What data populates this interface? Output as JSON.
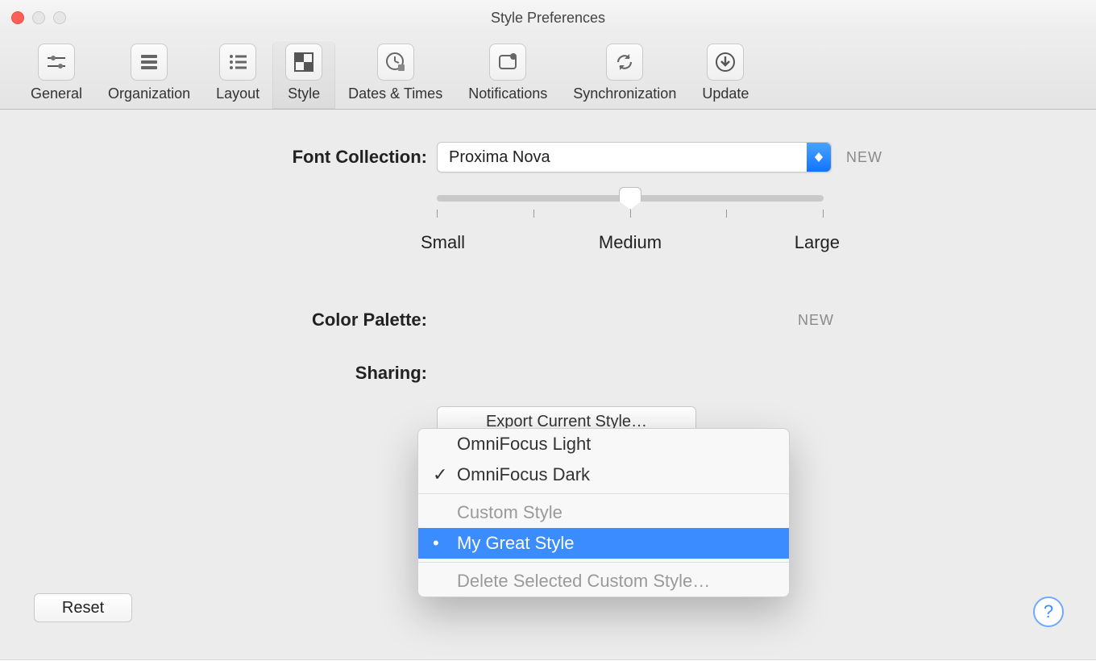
{
  "window": {
    "title": "Style Preferences"
  },
  "toolbar": {
    "items": [
      {
        "label": "General"
      },
      {
        "label": "Organization"
      },
      {
        "label": "Layout"
      },
      {
        "label": "Style"
      },
      {
        "label": "Dates & Times"
      },
      {
        "label": "Notifications"
      },
      {
        "label": "Synchronization"
      },
      {
        "label": "Update"
      }
    ],
    "active_index": 3
  },
  "font": {
    "label": "Font Collection:",
    "value": "Proxima Nova",
    "badge": "NEW"
  },
  "slider": {
    "labels": {
      "small": "Small",
      "medium": "Medium",
      "large": "Large"
    },
    "value_index": 2,
    "tick_count": 5
  },
  "palette": {
    "label": "Color Palette:",
    "badge": "NEW",
    "menu": {
      "opt_light": "OmniFocus Light",
      "opt_dark": "OmniFocus Dark",
      "checked_index": 1,
      "section_header": "Custom Style",
      "custom_item": "My Great Style",
      "custom_bullet": "•",
      "delete_label": "Delete Selected Custom Style…"
    }
  },
  "sharing": {
    "label": "Sharing:",
    "export_label": "Export Current Style…"
  },
  "reset_label": "Reset",
  "help_glyph": "?",
  "check_glyph": "✓"
}
